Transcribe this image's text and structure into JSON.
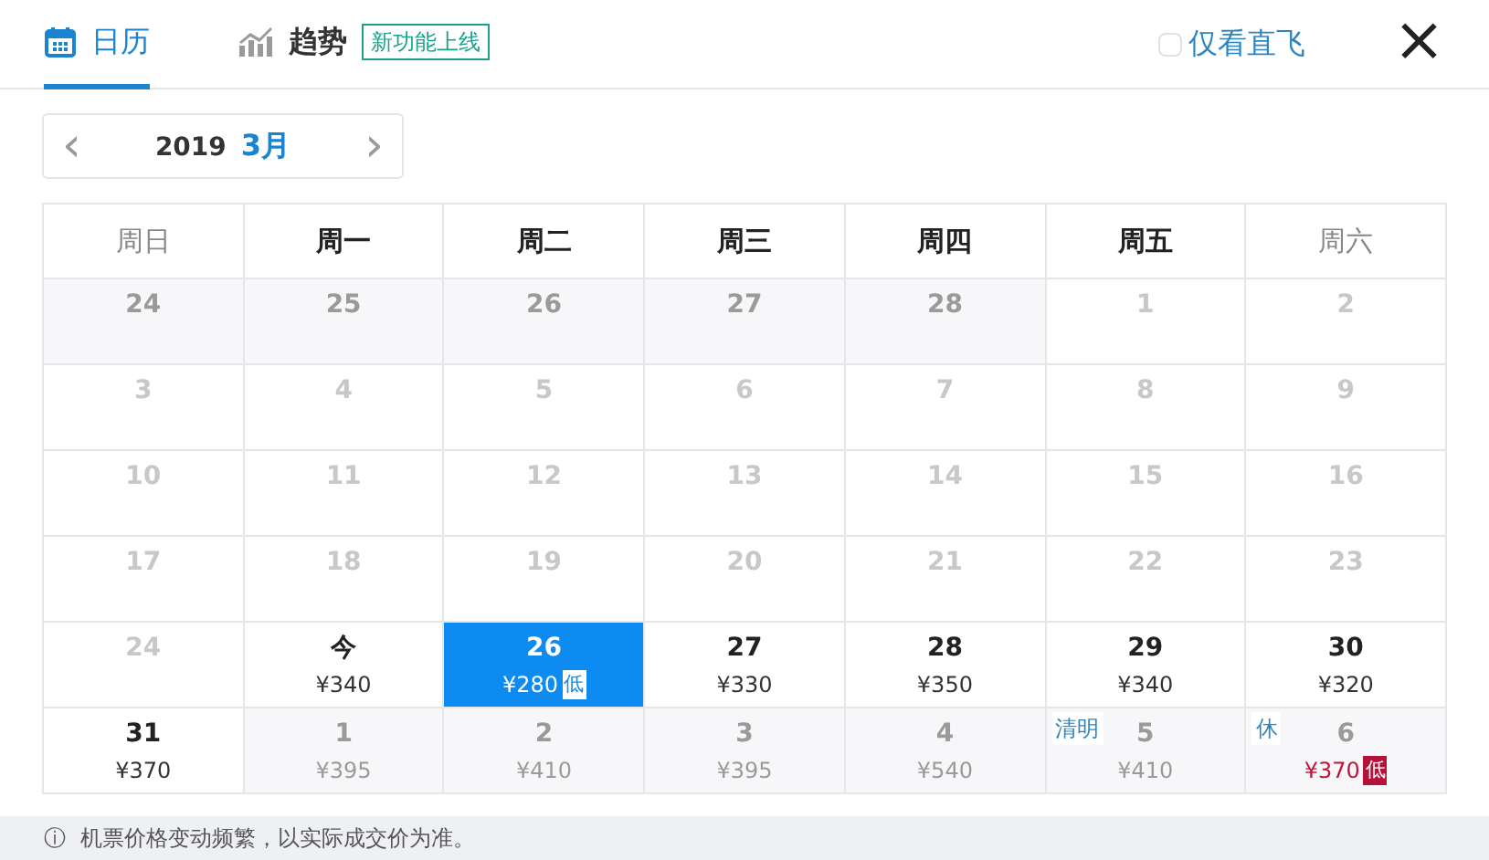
{
  "tabs": [
    {
      "label": "日历",
      "selected": true
    },
    {
      "label": "趋势",
      "selected": false,
      "badge": "新功能上线"
    }
  ],
  "direct_only": {
    "label": "仅看直飞",
    "checked": false
  },
  "close": "×",
  "month_nav": {
    "prev": "‹",
    "year": "2019",
    "month": "3月",
    "next": "›"
  },
  "weekdays": [
    {
      "label": "周日",
      "weekend": true
    },
    {
      "label": "周一",
      "weekend": false
    },
    {
      "label": "周二",
      "weekend": false
    },
    {
      "label": "周三",
      "weekend": false
    },
    {
      "label": "周四",
      "weekend": false
    },
    {
      "label": "周五",
      "weekend": false
    },
    {
      "label": "周六",
      "weekend": true
    }
  ],
  "days": [
    {
      "day": "24",
      "kind": "other",
      "selected": false
    },
    {
      "day": "25",
      "kind": "other",
      "selected": false
    },
    {
      "day": "26",
      "kind": "other",
      "selected": false
    },
    {
      "day": "27",
      "kind": "other",
      "selected": false
    },
    {
      "day": "28",
      "kind": "other",
      "selected": false
    },
    {
      "day": "1",
      "kind": "past",
      "selected": false
    },
    {
      "day": "2",
      "kind": "past",
      "selected": false
    },
    {
      "day": "3",
      "kind": "past",
      "selected": false
    },
    {
      "day": "4",
      "kind": "past",
      "selected": false
    },
    {
      "day": "5",
      "kind": "past",
      "selected": false
    },
    {
      "day": "6",
      "kind": "past",
      "selected": false
    },
    {
      "day": "7",
      "kind": "past",
      "selected": false
    },
    {
      "day": "8",
      "kind": "past",
      "selected": false
    },
    {
      "day": "9",
      "kind": "past",
      "selected": false
    },
    {
      "day": "10",
      "kind": "past",
      "selected": false
    },
    {
      "day": "11",
      "kind": "past",
      "selected": false
    },
    {
      "day": "12",
      "kind": "past",
      "selected": false
    },
    {
      "day": "13",
      "kind": "past",
      "selected": false
    },
    {
      "day": "14",
      "kind": "past",
      "selected": false
    },
    {
      "day": "15",
      "kind": "past",
      "selected": false
    },
    {
      "day": "16",
      "kind": "past",
      "selected": false
    },
    {
      "day": "17",
      "kind": "past",
      "selected": false
    },
    {
      "day": "18",
      "kind": "past",
      "selected": false
    },
    {
      "day": "19",
      "kind": "past",
      "selected": false
    },
    {
      "day": "20",
      "kind": "past",
      "selected": false
    },
    {
      "day": "21",
      "kind": "past",
      "selected": false
    },
    {
      "day": "22",
      "kind": "past",
      "selected": false
    },
    {
      "day": "23",
      "kind": "past",
      "selected": false
    },
    {
      "day": "24",
      "kind": "past",
      "selected": false
    },
    {
      "day": "今",
      "kind": "open",
      "selected": false,
      "price": "¥340"
    },
    {
      "day": "26",
      "kind": "open",
      "selected": true,
      "price": "¥280",
      "low": "低"
    },
    {
      "day": "27",
      "kind": "open",
      "selected": false,
      "price": "¥330"
    },
    {
      "day": "28",
      "kind": "open",
      "selected": false,
      "price": "¥350"
    },
    {
      "day": "29",
      "kind": "open",
      "selected": false,
      "price": "¥340"
    },
    {
      "day": "30",
      "kind": "open",
      "selected": false,
      "price": "¥320"
    },
    {
      "day": "31",
      "kind": "open",
      "selected": false,
      "price": "¥370"
    },
    {
      "day": "1",
      "kind": "other",
      "selected": false,
      "price": "¥395"
    },
    {
      "day": "2",
      "kind": "other",
      "selected": false,
      "price": "¥410"
    },
    {
      "day": "3",
      "kind": "other",
      "selected": false,
      "price": "¥395"
    },
    {
      "day": "4",
      "kind": "other",
      "selected": false,
      "price": "¥540"
    },
    {
      "day": "5",
      "kind": "other",
      "selected": false,
      "price": "¥410",
      "holiday": "清明"
    },
    {
      "day": "6",
      "kind": "other",
      "selected": false,
      "price": "¥370",
      "low": "低",
      "holiday": "休"
    }
  ],
  "notice": {
    "icon": "ⓘ",
    "text": "机票价格变动频繁，以实际成交价为准。"
  }
}
